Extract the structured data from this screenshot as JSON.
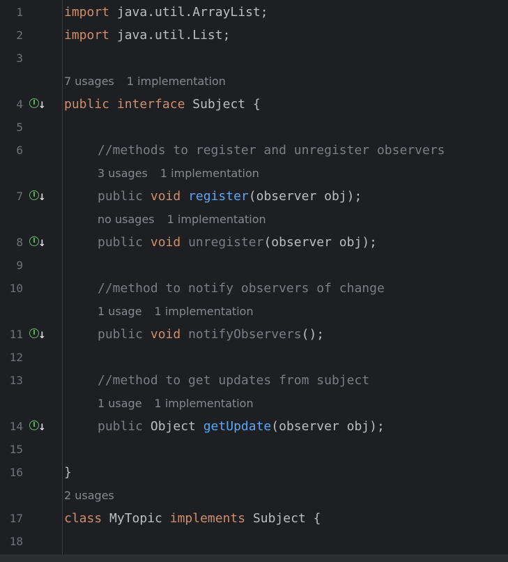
{
  "editor": {
    "lines": [
      {
        "n": "1",
        "kind": "code",
        "parts": [
          [
            "kw",
            "import"
          ],
          [
            "pl",
            " java.util.ArrayList;"
          ]
        ]
      },
      {
        "n": "2",
        "kind": "code",
        "parts": [
          [
            "kw",
            "import"
          ],
          [
            "pl",
            " java.util.List;"
          ]
        ]
      },
      {
        "n": "3",
        "kind": "code",
        "parts": []
      },
      {
        "kind": "hint",
        "indent": 0,
        "parts": [
          "7 usages",
          "1 implementation"
        ]
      },
      {
        "n": "4",
        "kind": "code",
        "impl": true,
        "parts": [
          [
            "kw",
            "public"
          ],
          [
            "pl",
            " "
          ],
          [
            "kw",
            "interface"
          ],
          [
            "pl",
            " Subject {"
          ]
        ]
      },
      {
        "n": "5",
        "kind": "code",
        "parts": []
      },
      {
        "n": "6",
        "kind": "code",
        "indent": 1,
        "parts": [
          [
            "cm",
            "//methods to register and unregister observers"
          ]
        ]
      },
      {
        "kind": "hint",
        "indent": 1,
        "parts": [
          "3 usages",
          "1 implementation"
        ]
      },
      {
        "n": "7",
        "kind": "code",
        "impl": true,
        "indent": 1,
        "parts": [
          [
            "cm",
            "public "
          ],
          [
            "kw",
            "void"
          ],
          [
            "pl",
            " "
          ],
          [
            "fn",
            "register"
          ],
          [
            "pl",
            "(observer obj);"
          ]
        ]
      },
      {
        "kind": "hint",
        "indent": 1,
        "parts": [
          "no usages",
          "1 implementation"
        ]
      },
      {
        "n": "8",
        "kind": "code",
        "impl": true,
        "indent": 1,
        "parts": [
          [
            "cm",
            "public "
          ],
          [
            "kw",
            "void"
          ],
          [
            "pl",
            " "
          ],
          [
            "cm",
            "unregister"
          ],
          [
            "pl",
            "(observer obj);"
          ]
        ]
      },
      {
        "n": "9",
        "kind": "code",
        "parts": []
      },
      {
        "n": "10",
        "kind": "code",
        "indent": 1,
        "parts": [
          [
            "cm",
            "//method to notify observers of change"
          ]
        ]
      },
      {
        "kind": "hint",
        "indent": 1,
        "parts": [
          "1 usage",
          "1 implementation"
        ]
      },
      {
        "n": "11",
        "kind": "code",
        "impl": true,
        "indent": 1,
        "parts": [
          [
            "cm",
            "public "
          ],
          [
            "kw",
            "void"
          ],
          [
            "pl",
            " "
          ],
          [
            "cm",
            "notifyObservers"
          ],
          [
            "pl",
            "();"
          ]
        ]
      },
      {
        "n": "12",
        "kind": "code",
        "parts": []
      },
      {
        "n": "13",
        "kind": "code",
        "indent": 1,
        "parts": [
          [
            "cm",
            "//method to get updates from subject"
          ]
        ]
      },
      {
        "kind": "hint",
        "indent": 1,
        "parts": [
          "1 usage",
          "1 implementation"
        ]
      },
      {
        "n": "14",
        "kind": "code",
        "impl": true,
        "indent": 1,
        "parts": [
          [
            "cm",
            "public "
          ],
          [
            "pl",
            "Object "
          ],
          [
            "fn",
            "getUpdate"
          ],
          [
            "pl",
            "(observer obj);"
          ]
        ]
      },
      {
        "n": "15",
        "kind": "code",
        "parts": []
      },
      {
        "n": "16",
        "kind": "code",
        "parts": [
          [
            "pl",
            "}"
          ]
        ]
      },
      {
        "kind": "hint",
        "indent": 0,
        "parts": [
          "2 usages"
        ]
      },
      {
        "n": "17",
        "kind": "code",
        "parts": [
          [
            "kw",
            "class"
          ],
          [
            "pl",
            " MyTopic "
          ],
          [
            "kw",
            "implements"
          ],
          [
            "pl",
            " Subject {"
          ]
        ]
      },
      {
        "n": "18",
        "kind": "code",
        "parts": []
      }
    ],
    "impl_icon": {
      "letter": "I",
      "arrow": "↓",
      "icon": "implemented-icon"
    },
    "colors": {
      "background": "#1e1f22",
      "keyword": "#cf8e6d",
      "method": "#56a8f5",
      "comment": "#7a7e85",
      "text": "#bcbec4",
      "hint": "#868a91",
      "line_number": "#6f737a",
      "impl_icon": "#5fb865"
    }
  }
}
